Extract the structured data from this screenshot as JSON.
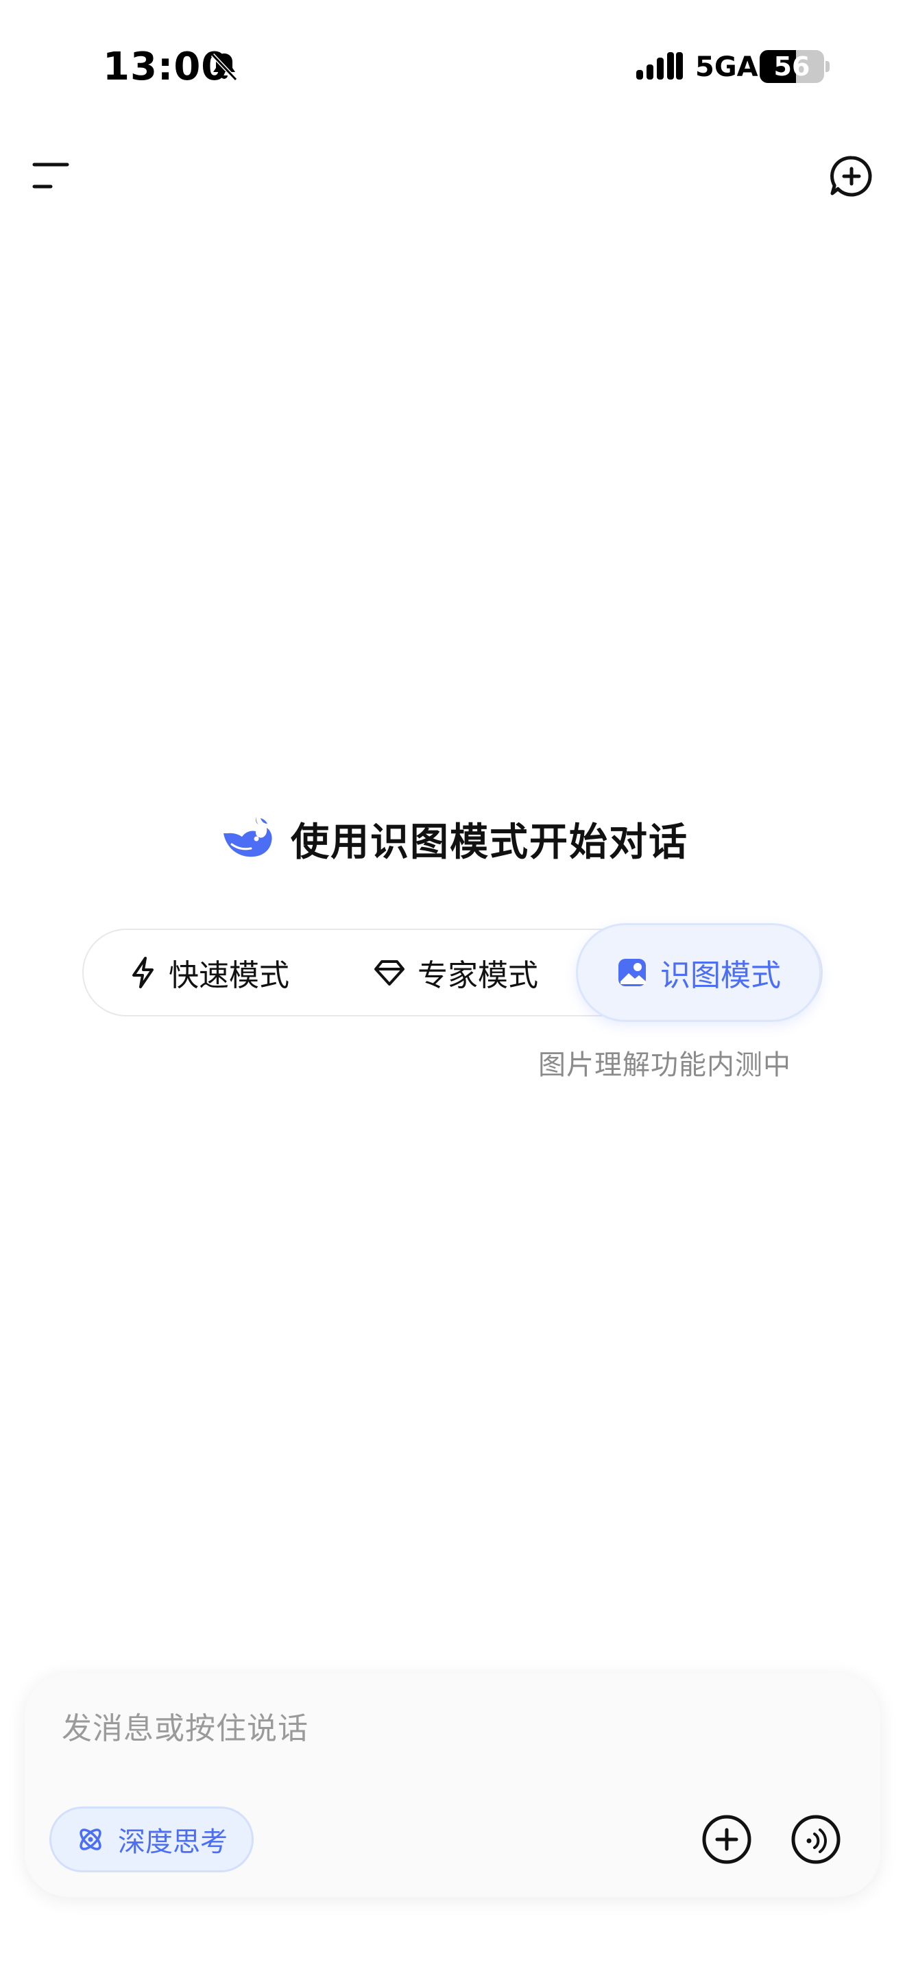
{
  "status_bar": {
    "time": "13:00",
    "network": "5GA",
    "battery_level": "56",
    "battery_fraction": 0.56,
    "bell_icon": "bell-slash-icon",
    "signal_icon": "signal-dots-icon"
  },
  "top_bar": {
    "menu_icon": "menu-icon",
    "new_chat_icon": "new-chat-plus-icon"
  },
  "main": {
    "heading": "使用识图模式开始对话",
    "logo_icon": "whale-logo-icon",
    "modes": [
      {
        "label": "快速模式",
        "icon": "lightning-icon",
        "selected": false
      },
      {
        "label": "专家模式",
        "icon": "diamond-icon",
        "selected": false
      },
      {
        "label": "识图模式",
        "icon": "image-icon",
        "selected": true
      }
    ],
    "note": "图片理解功能内测中"
  },
  "composer": {
    "placeholder": "发消息或按住说话",
    "deep_think_label": "深度思考",
    "deep_think_icon": "atom-icon",
    "attach_icon": "plus-circle-icon",
    "voice_icon": "voice-wave-icon"
  },
  "colors": {
    "accent": "#4C6EF5",
    "selected_bg": "#EEF3FD",
    "text": "#111111",
    "muted": "#8B8B8B"
  }
}
